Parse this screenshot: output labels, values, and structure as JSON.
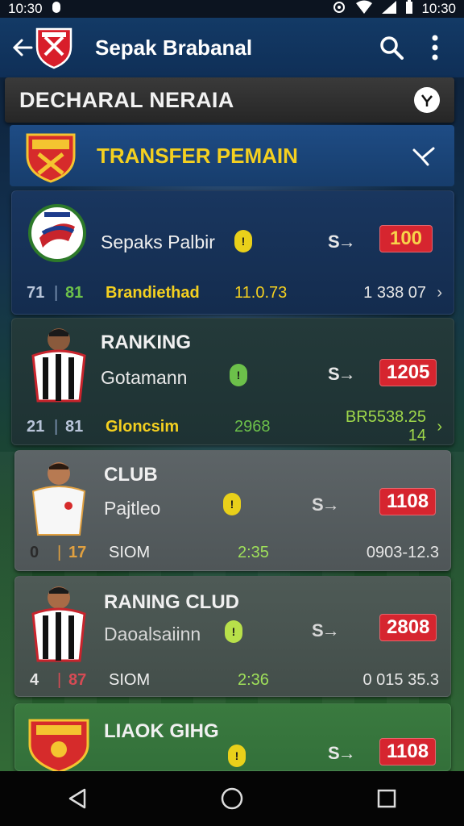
{
  "status_bar": {
    "time_left": "10:30",
    "time_right": "10:30"
  },
  "app_bar": {
    "title": "Sepak Brabanal",
    "icons": [
      "back-arrow-icon",
      "club-crest-icon",
      "search-icon",
      "more-vert-icon"
    ]
  },
  "section": {
    "title": "DECHARAL NERAIA"
  },
  "banner": {
    "title": "TRANSFER PEMAIN"
  },
  "cards": [
    {
      "name": "Sepaks Palbir",
      "score": "100",
      "swap": "S→",
      "footer": {
        "rank": "71",
        "num": "81",
        "label": "Brandiethad",
        "value": "11.0.73",
        "right": "1 338 07"
      }
    },
    {
      "name": "RANKING",
      "sub": "Gotamann",
      "score": "1205",
      "swap": "S→",
      "footer": {
        "rank": "21",
        "num": "81",
        "label": "Gloncsim",
        "value": "2968",
        "right": "BR5538.25 14"
      }
    },
    {
      "name": "CLUB",
      "sub": "Pajtleo",
      "score": "1108",
      "swap": "S→",
      "footer": {
        "rank": "0",
        "num": "17",
        "label": "SIOM",
        "value": "2:35",
        "right": "0903-12.3"
      }
    },
    {
      "name": "RANING CLUD",
      "sub": "Daoalsaiinn",
      "score": "2808",
      "swap": "S→",
      "footer": {
        "rank": "4",
        "num": "87",
        "label": "SIOM",
        "value": "2:36",
        "right": "0 015 35.3"
      }
    },
    {
      "name": "LIAOK GIHG",
      "score": "1108",
      "swap": "S→"
    }
  ],
  "colors": {
    "accent_yellow": "#f4d020",
    "badge_red": "#d6252f",
    "status_green": "#6cc04a",
    "status_yellow": "#e9d01a"
  }
}
